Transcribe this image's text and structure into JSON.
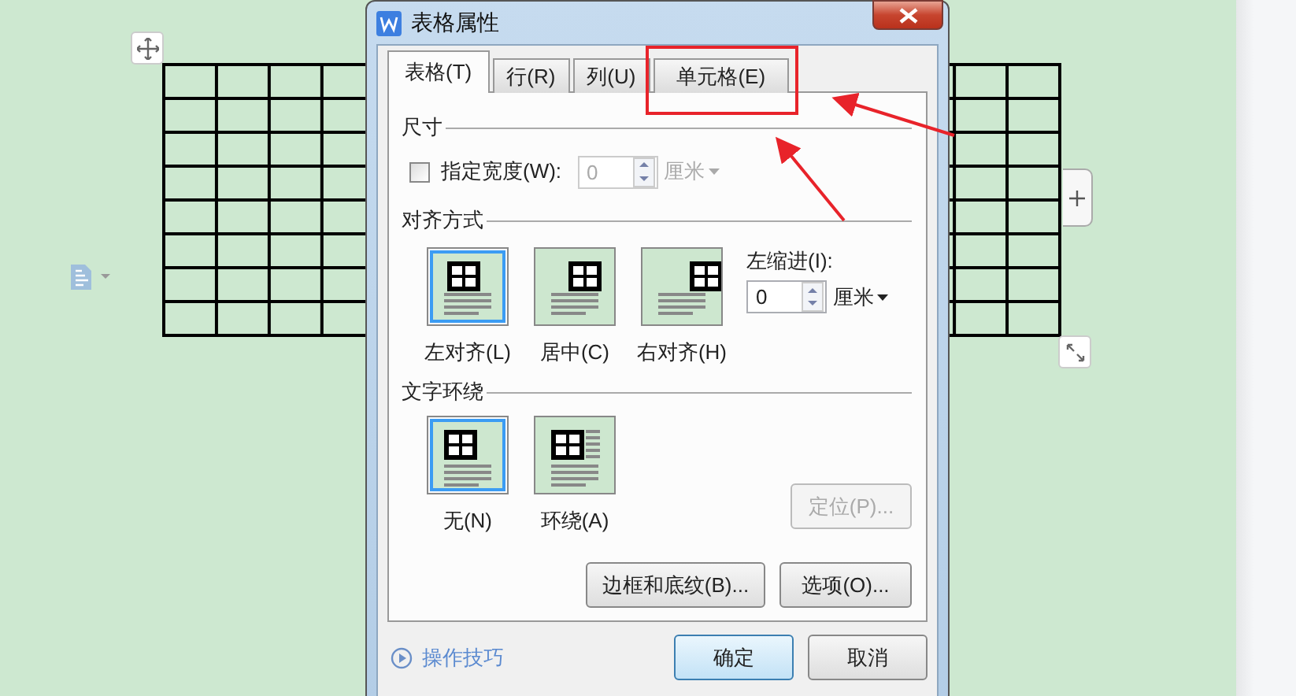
{
  "window": {
    "title": "表格属性"
  },
  "tabs": [
    {
      "label": "表格(T)",
      "selected": true
    },
    {
      "label": "行(R)",
      "selected": false
    },
    {
      "label": "列(U)",
      "selected": false
    },
    {
      "label": "单元格(E)",
      "selected": false
    }
  ],
  "size": {
    "heading": "尺寸",
    "width_checkbox": {
      "label": "指定宽度(W):",
      "checked": false
    },
    "width_field": {
      "value": "0",
      "disabled": true
    },
    "unit": {
      "label": "厘米",
      "disabled": true
    }
  },
  "alignment": {
    "heading": "对齐方式",
    "options": [
      {
        "label": "左对齐(L)",
        "kind": "left",
        "selected": true
      },
      {
        "label": "居中(C)",
        "kind": "center",
        "selected": false
      },
      {
        "label": "右对齐(H)",
        "kind": "right",
        "selected": false
      }
    ],
    "indent": {
      "label": "左缩进(I):",
      "value": "0",
      "unit": "厘米"
    }
  },
  "wrapping": {
    "heading": "文字环绕",
    "options": [
      {
        "label": "无(N)",
        "kind": "none",
        "selected": true
      },
      {
        "label": "环绕(A)",
        "kind": "around",
        "selected": false
      }
    ],
    "position_button": {
      "label": "定位(P)...",
      "disabled": true
    }
  },
  "buttons": [
    {
      "label": "边框和底纹(B)..."
    },
    {
      "label": "选项(O)..."
    }
  ],
  "footer": {
    "tips_link": "操作技巧",
    "buttons": [
      {
        "label": "确定",
        "default": true
      },
      {
        "label": "取消",
        "default": false
      }
    ]
  }
}
